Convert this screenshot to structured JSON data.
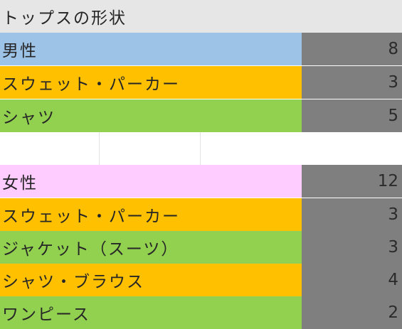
{
  "title": "トップスの形状",
  "sections": [
    {
      "header": {
        "label": "男性",
        "value": "8",
        "color": "#9dc3e6"
      },
      "rows": [
        {
          "label": "スウェット・パーカー",
          "value": "3",
          "color": "#ffc000"
        },
        {
          "label": "シャツ",
          "value": "5",
          "color": "#92d050"
        }
      ]
    },
    {
      "header": {
        "label": "女性",
        "value": "12",
        "color": "#ffccff"
      },
      "rows": [
        {
          "label": "スウェット・パーカー",
          "value": "3",
          "color": "#ffc000"
        },
        {
          "label": "ジャケット（スーツ）",
          "value": "3",
          "color": "#92d050"
        },
        {
          "label": "シャツ・ブラウス",
          "value": "4",
          "color": "#ffc000"
        },
        {
          "label": "ワンピース",
          "value": "2",
          "color": "#92d050"
        }
      ]
    }
  ],
  "value_cell_color": "#7f7f7f"
}
